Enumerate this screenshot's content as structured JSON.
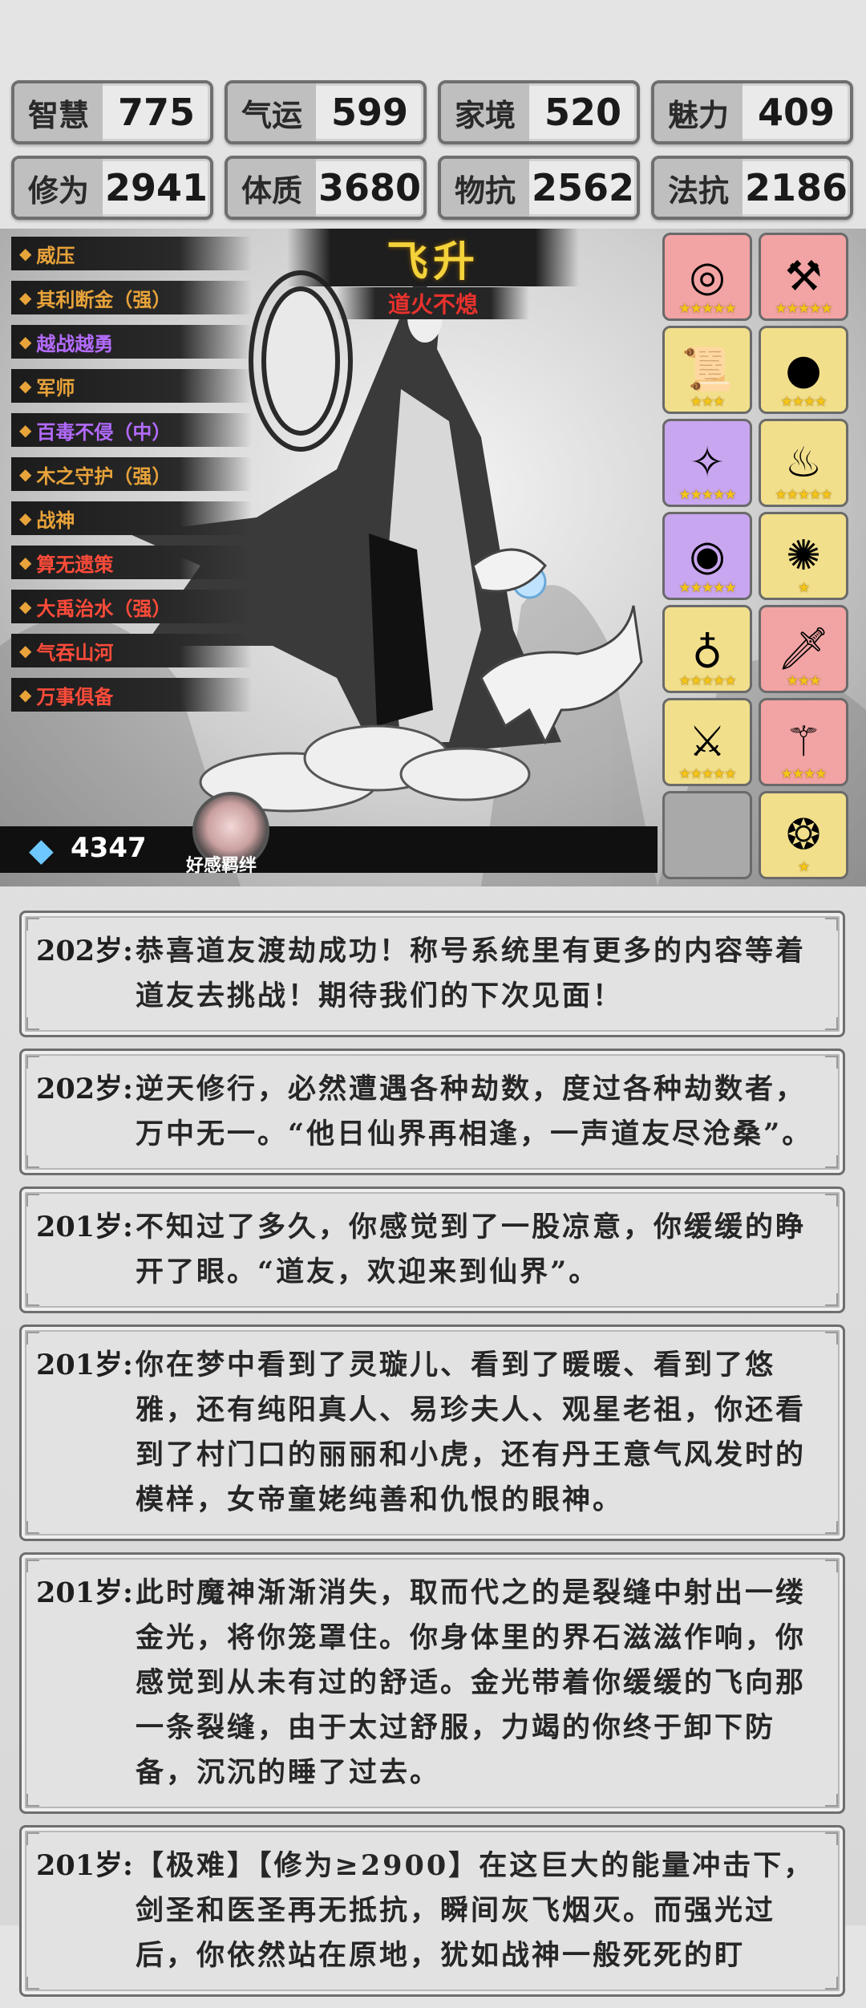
{
  "stats": [
    {
      "label": "智慧",
      "value": "775"
    },
    {
      "label": "气运",
      "value": "599"
    },
    {
      "label": "家境",
      "value": "520"
    },
    {
      "label": "魅力",
      "value": "409"
    },
    {
      "label": "修为",
      "value": "2941"
    },
    {
      "label": "体质",
      "value": "3680"
    },
    {
      "label": "物抗",
      "value": "2562"
    },
    {
      "label": "法抗",
      "value": "2186"
    }
  ],
  "banner": {
    "title": "飞升",
    "subtitle": "道火不熄"
  },
  "traits": [
    {
      "label": "威压",
      "color": "#e8a33a"
    },
    {
      "label": "其利断金（强）",
      "color": "#e8a33a"
    },
    {
      "label": "越战越勇",
      "color": "#b36bff"
    },
    {
      "label": "军师",
      "color": "#e8a33a"
    },
    {
      "label": "百毒不侵（中）",
      "color": "#b36bff"
    },
    {
      "label": "木之守护（强）",
      "color": "#e8a33a"
    },
    {
      "label": "战神",
      "color": "#e8a33a"
    },
    {
      "label": "算无遗策",
      "color": "#ff4b3a"
    },
    {
      "label": "大禹治水（强）",
      "color": "#ff4b3a"
    },
    {
      "label": "气吞山河",
      "color": "#ff4b3a"
    },
    {
      "label": "万事俱备",
      "color": "#ff4b3a"
    }
  ],
  "items": [
    {
      "icon": "mirror-icon",
      "glyph": "◎",
      "bg": "#f2a3a3",
      "stars": "★★★★★"
    },
    {
      "icon": "axe-icon",
      "glyph": "⚒",
      "bg": "#f2a3a3",
      "stars": "★★★★★"
    },
    {
      "icon": "scroll-icon",
      "glyph": "📜",
      "bg": "#f2df8c",
      "stars": "★★★"
    },
    {
      "icon": "orb-icon",
      "glyph": "●",
      "bg": "#f2df8c",
      "stars": "★★★★"
    },
    {
      "icon": "amulet-icon",
      "glyph": "✧",
      "bg": "#c9a6f0",
      "stars": "★★★★★"
    },
    {
      "icon": "horn-icon",
      "glyph": "♨",
      "bg": "#f2df8c",
      "stars": "★★★★★"
    },
    {
      "icon": "ring-icon",
      "glyph": "◉",
      "bg": "#c9a6f0",
      "stars": "★★★★★"
    },
    {
      "icon": "rattle-icon",
      "glyph": "✺",
      "bg": "#f2df8c",
      "stars": "★"
    },
    {
      "icon": "cauldron-icon",
      "glyph": "♁",
      "bg": "#f2df8c",
      "stars": "★★★★★"
    },
    {
      "icon": "sword-icon",
      "glyph": "🗡",
      "bg": "#f2a3a3",
      "stars": "★★★"
    },
    {
      "icon": "dagger-icon",
      "glyph": "⚔",
      "bg": "#f2df8c",
      "stars": "★★★★★"
    },
    {
      "icon": "staff-icon",
      "glyph": "⚚",
      "bg": "#f2a3a3",
      "stars": "★★★★"
    },
    {
      "icon": "empty-slot-icon",
      "glyph": "",
      "bg": "#a9a9a9",
      "stars": ""
    },
    {
      "icon": "fan-icon",
      "glyph": "❂",
      "bg": "#f2df8c",
      "stars": "★"
    }
  ],
  "currency": {
    "icon": "crystal-icon",
    "value": "4347"
  },
  "bond": {
    "label": "好感羁绊"
  },
  "log": [
    {
      "age": "202岁:",
      "text": "恭喜道友渡劫成功！称号系统里有更多的内容等着道友去挑战！期待我们的下次见面！"
    },
    {
      "age": "202岁:",
      "text": "逆天修行，必然遭遇各种劫数，度过各种劫数者，万中无一。“他日仙界再相逢，一声道友尽沧桑”。"
    },
    {
      "age": "201岁:",
      "text": "不知过了多久，你感觉到了一股凉意，你缓缓的睁开了眼。“道友，欢迎来到仙界”。"
    },
    {
      "age": "201岁:",
      "text": "你在梦中看到了灵璇儿、看到了暖暖、看到了悠雅，还有纯阳真人、易珍夫人、观星老祖，你还看到了村门口的丽丽和小虎，还有丹王意气风发时的模样，女帝童姥纯善和仇恨的眼神。"
    },
    {
      "age": "201岁:",
      "text": "此时魔神渐渐消失，取而代之的是裂缝中射出一缕金光，将你笼罩住。你身体里的界石滋滋作响，你感觉到从未有过的舒适。金光带着你缓缓的飞向那一条裂缝，由于太过舒服，力竭的你终于卸下防备，沉沉的睡了过去。"
    },
    {
      "age": "201岁:",
      "text": "【极难】【修为≥2900】在这巨大的能量冲击下，剑圣和医圣再无抵抗，瞬间灰飞烟灭。而强光过后，你依然站在原地，犹如战神一般死死的盯"
    }
  ]
}
